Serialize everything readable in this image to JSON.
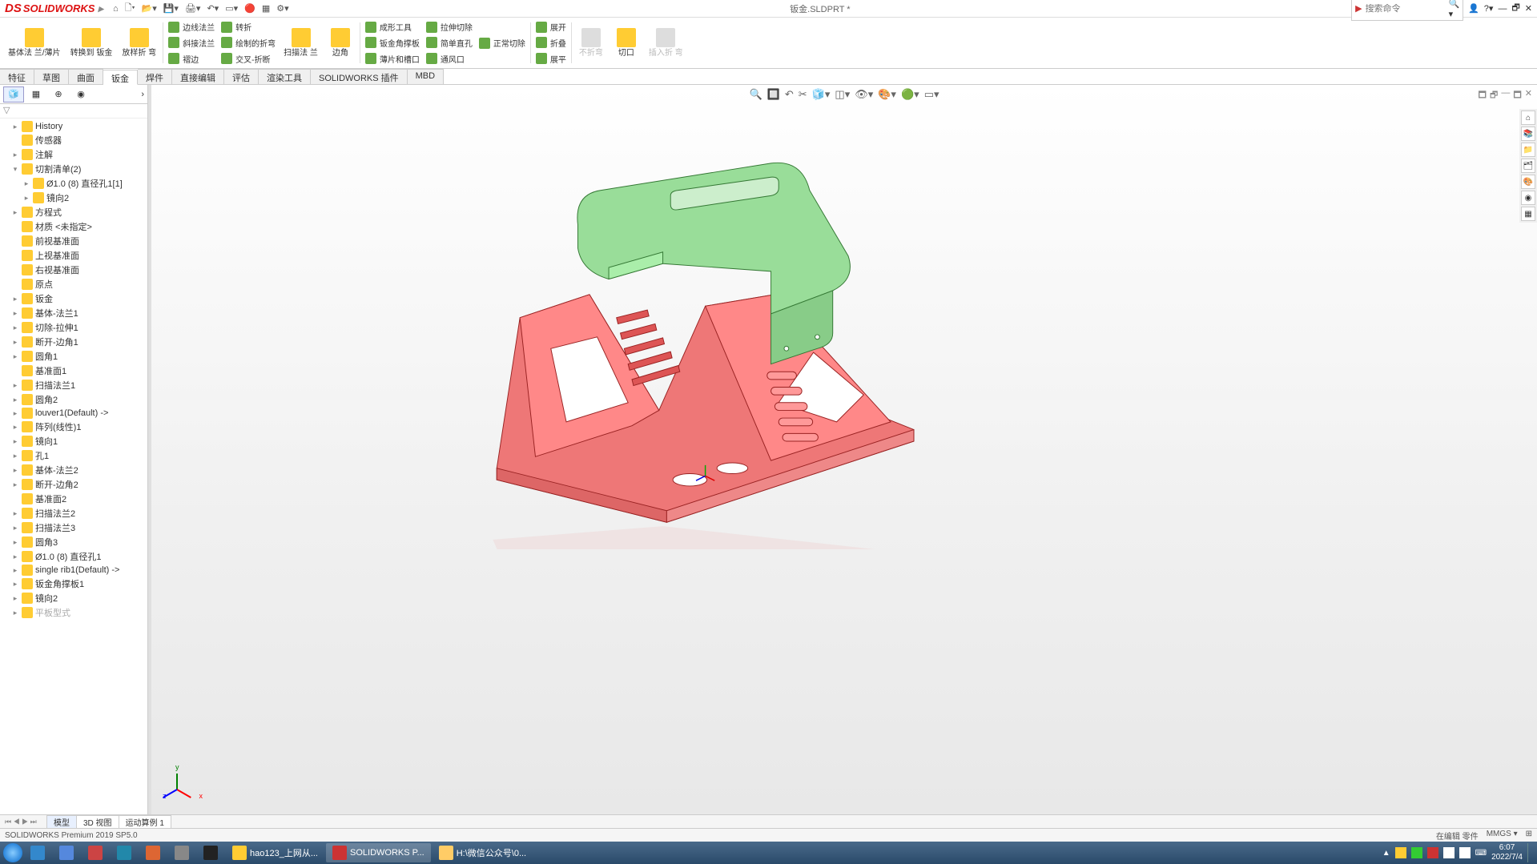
{
  "title_bar": {
    "logo_text": "SOLIDWORKS",
    "doc_title": "钣金.SLDPRT *",
    "search_placeholder": "搜索命令"
  },
  "ribbon_large": [
    {
      "label": "基体法\n兰/薄片"
    },
    {
      "label": "转换到\n钣金"
    },
    {
      "label": "放样折\n弯"
    }
  ],
  "ribbon_cols": [
    [
      {
        "label": "边线法兰"
      },
      {
        "label": "褶边"
      },
      {
        "label": "斜接法兰"
      }
    ],
    [
      {
        "label": "转折"
      },
      {
        "label": "交叉-折断"
      },
      {
        "label": "绘制的折弯"
      }
    ]
  ],
  "ribbon_large2": [
    {
      "label": "扫描法\n兰"
    },
    {
      "label": "边角"
    }
  ],
  "ribbon_cols2": [
    [
      {
        "label": "成形工具"
      },
      {
        "label": "钣金角撑板"
      },
      {
        "label": "薄片和槽口"
      }
    ],
    [
      {
        "label": "拉伸切除"
      },
      {
        "label": "简单直孔"
      },
      {
        "label": "通风口"
      }
    ],
    [
      {
        "label": "正常切除"
      },
      {
        "label": ""
      },
      {
        "label": ""
      }
    ]
  ],
  "ribbon_large3": [
    {
      "label": "展开"
    },
    {
      "label": "折叠"
    },
    {
      "label": "展平"
    }
  ],
  "ribbon_disabled": [
    {
      "label": "不折弯"
    },
    {
      "label": "切口"
    },
    {
      "label": "插入折\n弯"
    }
  ],
  "command_tabs": [
    "特征",
    "草图",
    "曲面",
    "钣金",
    "焊件",
    "直接编辑",
    "评估",
    "渲染工具",
    "SOLIDWORKS 插件",
    "MBD"
  ],
  "active_cmd_tab": "钣金",
  "tree": [
    {
      "d": 1,
      "exp": "▸",
      "label": "History"
    },
    {
      "d": 1,
      "exp": "",
      "label": "传感器"
    },
    {
      "d": 1,
      "exp": "▸",
      "label": "注解"
    },
    {
      "d": 1,
      "exp": "▾",
      "label": "切割清单(2)"
    },
    {
      "d": 2,
      "exp": "▸",
      "label": "Ø1.0 (8) 直径孔1[1]"
    },
    {
      "d": 2,
      "exp": "▸",
      "label": "镜向2"
    },
    {
      "d": 1,
      "exp": "▸",
      "label": "方程式"
    },
    {
      "d": 1,
      "exp": "",
      "label": "材质 <未指定>"
    },
    {
      "d": 1,
      "exp": "",
      "label": "前视基准面"
    },
    {
      "d": 1,
      "exp": "",
      "label": "上视基准面"
    },
    {
      "d": 1,
      "exp": "",
      "label": "右视基准面"
    },
    {
      "d": 1,
      "exp": "",
      "label": "原点"
    },
    {
      "d": 1,
      "exp": "▸",
      "label": "钣金"
    },
    {
      "d": 1,
      "exp": "▸",
      "label": "基体-法兰1"
    },
    {
      "d": 1,
      "exp": "▸",
      "label": "切除-拉伸1"
    },
    {
      "d": 1,
      "exp": "▸",
      "label": "断开-边角1"
    },
    {
      "d": 1,
      "exp": "▸",
      "label": "圆角1"
    },
    {
      "d": 1,
      "exp": "",
      "label": "基准面1"
    },
    {
      "d": 1,
      "exp": "▸",
      "label": "扫描法兰1"
    },
    {
      "d": 1,
      "exp": "▸",
      "label": "圆角2"
    },
    {
      "d": 1,
      "exp": "▸",
      "label": "louver1(Default) ->"
    },
    {
      "d": 1,
      "exp": "▸",
      "label": "阵列(线性)1"
    },
    {
      "d": 1,
      "exp": "▸",
      "label": "镜向1"
    },
    {
      "d": 1,
      "exp": "▸",
      "label": "孔1"
    },
    {
      "d": 1,
      "exp": "▸",
      "label": "基体-法兰2"
    },
    {
      "d": 1,
      "exp": "▸",
      "label": "断开-边角2"
    },
    {
      "d": 1,
      "exp": "",
      "label": "基准面2"
    },
    {
      "d": 1,
      "exp": "▸",
      "label": "扫描法兰2"
    },
    {
      "d": 1,
      "exp": "▸",
      "label": "扫描法兰3"
    },
    {
      "d": 1,
      "exp": "▸",
      "label": "圆角3"
    },
    {
      "d": 1,
      "exp": "▸",
      "label": "Ø1.0 (8) 直径孔1"
    },
    {
      "d": 1,
      "exp": "▸",
      "label": "single rib1(Default) ->"
    },
    {
      "d": 1,
      "exp": "▸",
      "label": "钣金角撑板1"
    },
    {
      "d": 1,
      "exp": "▸",
      "label": "镜向2"
    },
    {
      "d": 1,
      "exp": "▸",
      "label": "平板型式",
      "gray": true
    }
  ],
  "bottom_tabs": [
    "模型",
    "3D 视图",
    "运动算例 1"
  ],
  "active_bottom_tab": "模型",
  "status": {
    "left": "SOLIDWORKS Premium 2019 SP5.0",
    "mode": "在编辑 零件",
    "units": "MMGS",
    "extra": "▾"
  },
  "taskbar": {
    "items": [
      {
        "label": "",
        "color": "#38c"
      },
      {
        "label": "",
        "color": "#58d"
      },
      {
        "label": "",
        "color": "#c44"
      },
      {
        "label": "",
        "color": "#28a"
      },
      {
        "label": "",
        "color": "#d63"
      },
      {
        "label": "",
        "color": "#888"
      },
      {
        "label": "",
        "color": "#222"
      },
      {
        "label": "hao123_上网从...",
        "color": "#fc3",
        "active": false
      },
      {
        "label": "SOLIDWORKS P...",
        "color": "#c33",
        "active": true
      },
      {
        "label": "H:\\微信公众号\\0...",
        "color": "#fc6",
        "active": false
      }
    ],
    "time": "6:07",
    "date": "2022/7/4"
  },
  "triad": {
    "x": "x",
    "y": "y",
    "z": "z"
  }
}
